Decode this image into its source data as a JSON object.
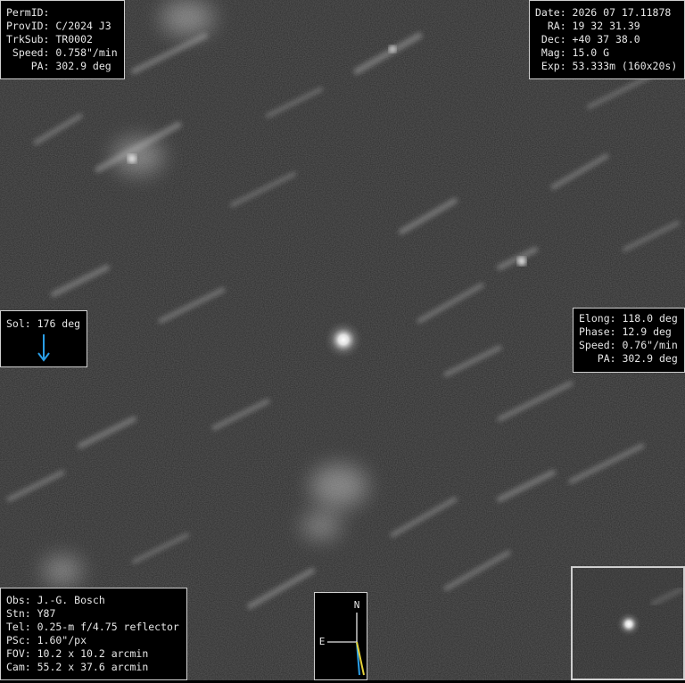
{
  "top_left": [
    "PermID:",
    "ProvID: C/2024 J3",
    "TrkSub: TR0002",
    " Speed: 0.758\"/min",
    "    PA: 302.9 deg"
  ],
  "top_right": [
    "Date: 2026 07 17.11878",
    "  RA: 19 32 31.39",
    " Dec: +40 37 38.0",
    " Mag: 15.0 G",
    " Exp: 53.333m (160x20s)"
  ],
  "sol": {
    "label": "Sol: 176 deg",
    "arrow_color": "#2a9ee6"
  },
  "right_panel": [
    "Elong: 118.0 deg",
    "Phase: 12.9 deg",
    "Speed: 0.76\"/min",
    "   PA: 302.9 deg"
  ],
  "bottom_left": [
    "Obs: J.-G. Bosch",
    "Stn: Y87",
    "Tel: 0.25-m f/4.75 reflector",
    "PSc: 1.60\"/px",
    "FOV: 10.2 x 10.2 arcmin",
    "Cam: 55.2 x 37.6 arcmin"
  ],
  "compass": {
    "north_label": "N",
    "east_label": "E",
    "tail_color_a": "#2a9ee6",
    "tail_color_b": "#e6d23a"
  }
}
